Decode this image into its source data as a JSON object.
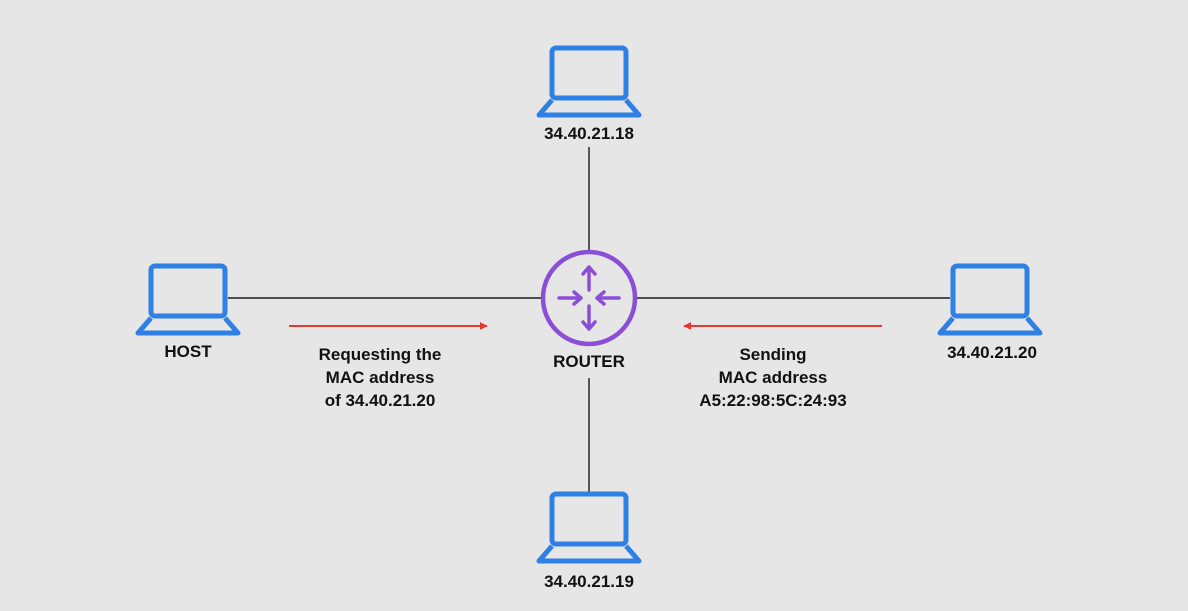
{
  "colors": {
    "background": "#e6e6e6",
    "laptop": "#2f80e4",
    "router": "#8a4fd6",
    "link": "#1a1a1a",
    "arrow": "#e23a2e"
  },
  "icons": {
    "router": "router-icon",
    "laptop": "laptop-icon",
    "arrow": "arrow-right-icon"
  },
  "nodes": {
    "top": {
      "label": "34.40.21.18"
    },
    "bottom": {
      "label": "34.40.21.19"
    },
    "host": {
      "label": "HOST"
    },
    "right": {
      "label": "34.40.21.20"
    },
    "router": {
      "label": "ROUTER"
    }
  },
  "messages": {
    "request": {
      "lines": [
        "Requesting the",
        "MAC address",
        "of 34.40.21.20"
      ]
    },
    "reply": {
      "lines": [
        "Sending",
        "MAC address",
        "A5:22:98:5C:24:93"
      ]
    }
  }
}
